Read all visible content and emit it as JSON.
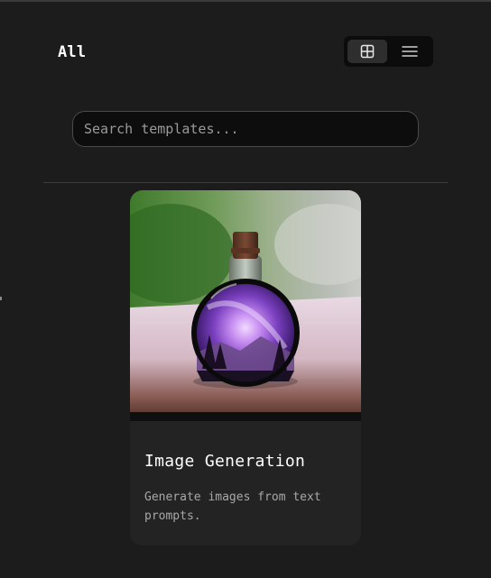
{
  "header": {
    "title": "All"
  },
  "view_toggle": {
    "options": [
      {
        "name": "grid",
        "icon": "grid-icon",
        "active": true
      },
      {
        "name": "list",
        "icon": "list-icon",
        "active": false
      }
    ]
  },
  "search": {
    "placeholder": "Search templates...",
    "value": ""
  },
  "templates": [
    {
      "title": "Image Generation",
      "description": "Generate images from text prompts.",
      "image": "potion-bottle-galaxy-image"
    }
  ],
  "colors": {
    "background": "#1c1c1c",
    "card": "#232323",
    "search_bg": "#0d0d0d",
    "toggle_bg": "#0c0c0c"
  }
}
